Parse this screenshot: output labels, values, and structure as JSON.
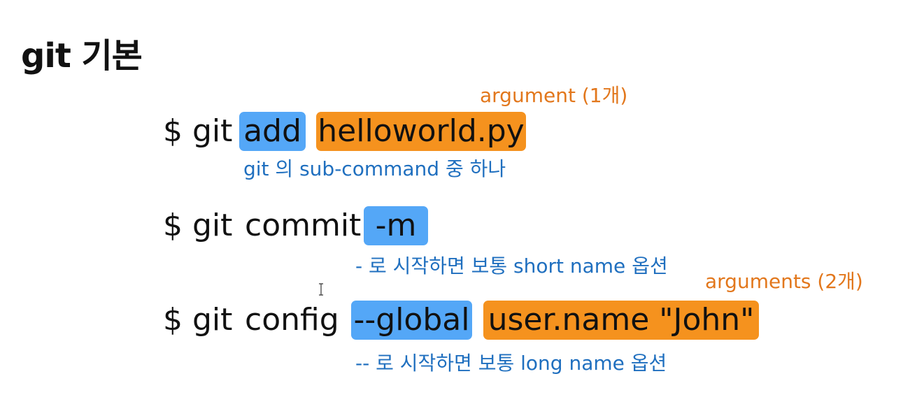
{
  "slide": {
    "title": "git 기본"
  },
  "commands": [
    {
      "prefix": "$ git",
      "parts": [
        "add",
        "helloworld.py"
      ],
      "note_above": "argument (1개)",
      "note_below": "git 의 sub-command 중 하나"
    },
    {
      "prefix": "$ git",
      "sub": "commit",
      "parts": [
        "-m"
      ],
      "note_below": "- 로 시작하면 보통 short name 옵션"
    },
    {
      "prefix": "$ git",
      "sub": "config",
      "parts": [
        "--global",
        "user.name  \"John\""
      ],
      "note_above": "arguments (2개)",
      "note_below": "-- 로 시작하면 보통 long name 옵션"
    }
  ],
  "colors": {
    "option_highlight": "#54a7f7",
    "argument_highlight": "#f5921e",
    "note_blue": "#1f6fbf",
    "note_orange": "#e2771c"
  },
  "icons": [
    "text-cursor-icon"
  ]
}
